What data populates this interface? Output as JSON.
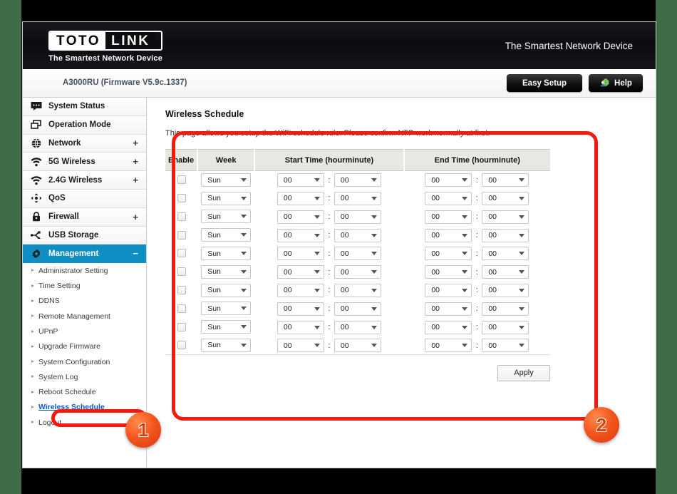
{
  "brand": {
    "logo_first": "TOTO",
    "logo_second": "LINK",
    "logo_tagline": "The Smartest Network Device",
    "banner_slogan": "The Smartest Network Device"
  },
  "header": {
    "firmware": "A3000RU (Firmware V5.9c.1337)",
    "easy_setup_label": "Easy Setup",
    "help_label": "Help"
  },
  "sidebar": {
    "items": [
      {
        "label": "System Status",
        "icon": "speech-bubble-icon",
        "expander": ""
      },
      {
        "label": "Operation Mode",
        "icon": "windows-icon",
        "expander": ""
      },
      {
        "label": "Network",
        "icon": "globe-icon",
        "expander": "+"
      },
      {
        "label": "5G Wireless",
        "icon": "wifi-icon",
        "expander": "+"
      },
      {
        "label": "2.4G Wireless",
        "icon": "wifi-icon",
        "expander": "+"
      },
      {
        "label": "QoS",
        "icon": "arrows-icon",
        "expander": ""
      },
      {
        "label": "Firewall",
        "icon": "lock-icon",
        "expander": "+"
      },
      {
        "label": "USB Storage",
        "icon": "usb-icon",
        "expander": ""
      },
      {
        "label": "Management",
        "icon": "gear-icon",
        "expander": "−",
        "active": true
      }
    ],
    "subitems": [
      {
        "label": "Administrator Setting"
      },
      {
        "label": "Time Setting"
      },
      {
        "label": "DDNS"
      },
      {
        "label": "Remote Management"
      },
      {
        "label": "UPnP"
      },
      {
        "label": "Upgrade Firmware"
      },
      {
        "label": "System Configuration"
      },
      {
        "label": "System Log"
      },
      {
        "label": "Reboot Schedule"
      },
      {
        "label": "Wireless Schedule",
        "selected": true
      },
      {
        "label": "Logout"
      }
    ]
  },
  "panel": {
    "title": "Wireless Schedule",
    "description": "This page allows you setup the WiFi schedule rule. Please confirm NTP work normally at first.",
    "apply_label": "Apply",
    "table": {
      "columns": [
        "Enable",
        "Week",
        "Start Time (hourminute)",
        "End Time (hourminute)"
      ],
      "colon": ":",
      "rows": [
        {
          "enabled": false,
          "week": "Sun",
          "start_hour": "00",
          "start_minute": "00",
          "end_hour": "00",
          "end_minute": "00"
        },
        {
          "enabled": false,
          "week": "Sun",
          "start_hour": "00",
          "start_minute": "00",
          "end_hour": "00",
          "end_minute": "00"
        },
        {
          "enabled": false,
          "week": "Sun",
          "start_hour": "00",
          "start_minute": "00",
          "end_hour": "00",
          "end_minute": "00"
        },
        {
          "enabled": false,
          "week": "Sun",
          "start_hour": "00",
          "start_minute": "00",
          "end_hour": "00",
          "end_minute": "00"
        },
        {
          "enabled": false,
          "week": "Sun",
          "start_hour": "00",
          "start_minute": "00",
          "end_hour": "00",
          "end_minute": "00"
        },
        {
          "enabled": false,
          "week": "Sun",
          "start_hour": "00",
          "start_minute": "00",
          "end_hour": "00",
          "end_minute": "00"
        },
        {
          "enabled": false,
          "week": "Sun",
          "start_hour": "00",
          "start_minute": "00",
          "end_hour": "00",
          "end_minute": "00"
        },
        {
          "enabled": false,
          "week": "Sun",
          "start_hour": "00",
          "start_minute": "00",
          "end_hour": "00",
          "end_minute": "00"
        },
        {
          "enabled": false,
          "week": "Sun",
          "start_hour": "00",
          "start_minute": "00",
          "end_hour": "00",
          "end_minute": "00"
        },
        {
          "enabled": false,
          "week": "Sun",
          "start_hour": "00",
          "start_minute": "00",
          "end_hour": "00",
          "end_minute": "00"
        }
      ]
    }
  },
  "annotations": {
    "badge_one": "1",
    "badge_two": "2",
    "color": "#f41b0e"
  }
}
